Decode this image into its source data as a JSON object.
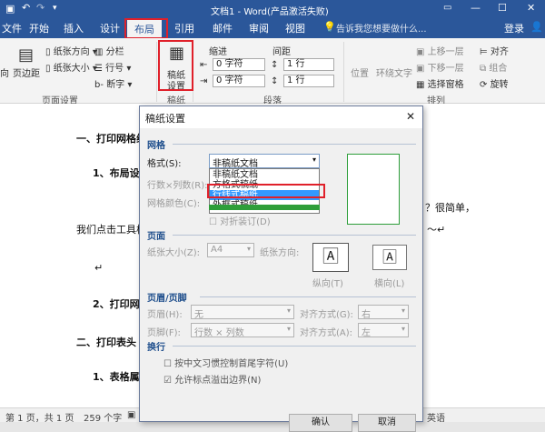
{
  "titlebar": {
    "doc_title": "文档1 - Word(产品激活失败)",
    "save_icon": "save-icon",
    "undo_icon": "undo-icon",
    "redo_icon": "redo-icon"
  },
  "tabs": [
    "文件",
    "开始",
    "插入",
    "设计",
    "布局",
    "引用",
    "邮件",
    "审阅",
    "视图"
  ],
  "search_hint": "告诉我您想要做什么...",
  "login": "登录",
  "ribbon": {
    "left_partial": [
      "向",
      "页边距"
    ],
    "page_setup": {
      "items": [
        "纸张方向",
        "纸张大小",
        "分栏",
        "分隔符",
        "行号",
        "断字"
      ],
      "label": "页面设置"
    },
    "draft_setup": {
      "label1": "稿纸",
      "label2": "设置",
      "group": "稿纸"
    },
    "indent": {
      "title": "缩进",
      "left": "0 字符",
      "right": "0 字符"
    },
    "spacing": {
      "title": "间距",
      "before": "1 行",
      "after": "1 行"
    },
    "paragraph_label": "段落",
    "arrange": {
      "position": "位置",
      "wrap": "环绕文字",
      "bring_forward": "上移一层",
      "send_backward": "下移一层",
      "selection_pane": "选择窗格",
      "align": "对齐",
      "group": "组合",
      "rotate": "旋转",
      "label": "排列"
    }
  },
  "document": {
    "h1": "一、打印网格线",
    "h1b": "1、布局设",
    "p1_end": "？很简单，",
    "p2": "我们点击工具栏",
    "p2_end": "～↵",
    "cursor": "↵",
    "h2": "2、打印网",
    "h3": "二、打印表头",
    "h3b": "1、表格属"
  },
  "status": {
    "pages": "第 1 页，共 1 页",
    "words": "259 个字",
    "lang": "英语"
  },
  "dialog": {
    "title": "稿纸设置",
    "close": "✕",
    "grid_section": "网格",
    "style_label": "格式(S):",
    "style_value": "非稿纸文档",
    "style_options": [
      "非稿纸文档",
      "方格式稿纸",
      "行线式稿纸",
      "外框式稿纸"
    ],
    "selected_option": "行线式稿纸",
    "rows_cols_label": "行数×列数(R):",
    "grid_color_label": "网格颜色(C):",
    "fold_label": "对折装订(D)",
    "page_section": "页面",
    "paper_size_label": "纸张大小(Z):",
    "paper_size_value": "A4",
    "orientation_label": "纸张方向:",
    "portrait": "纵向(T)",
    "landscape": "横向(L)",
    "hf_section": "页眉/页脚",
    "header_label": "页眉(H):",
    "header_value": "无",
    "header_align_label": "对齐方式(G):",
    "header_align_value": "右",
    "footer_label": "页脚(F):",
    "footer_value": "行数 × 列数",
    "footer_align_label": "对齐方式(A):",
    "footer_align_value": "左",
    "wrap_section": "换行",
    "opt1": "按中文习惯控制首尾字符(U)",
    "opt2": "允许标点溢出边界(N)",
    "ok": "确认",
    "cancel": "取消"
  },
  "colors": {
    "brand": "#2b579a",
    "highlight": "#e0202a",
    "selection": "#3399ff",
    "preview_border": "#2e9e3a"
  }
}
